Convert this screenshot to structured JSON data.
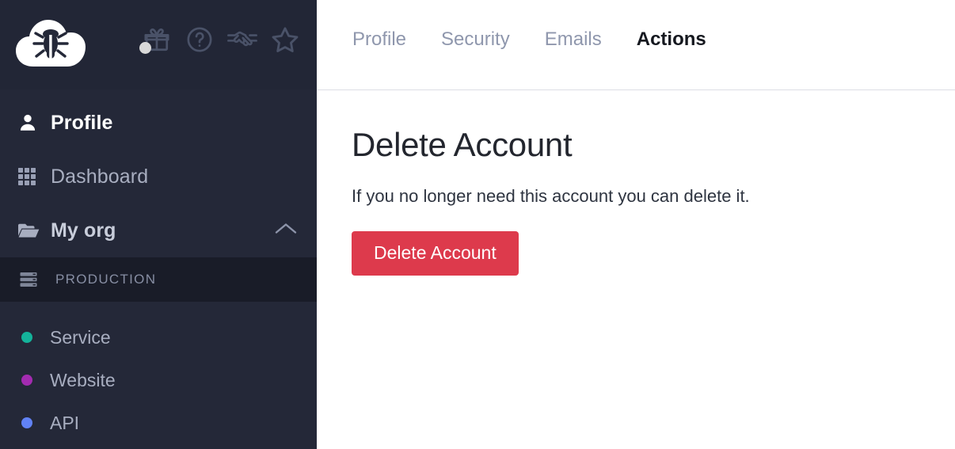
{
  "app": {
    "logo_icon": "cloud-bug-logo",
    "theme": {
      "sidebar_bg": "#242838",
      "sidebar_header_bg": "#222636",
      "env_row_bg": "#191c28",
      "content_bg": "#ffffff",
      "muted_text": "#a8aec0",
      "danger": "#dd3a4c",
      "active_tab": "#15181f"
    }
  },
  "header": {
    "icons": [
      {
        "name": "gift-icon",
        "label": "Gift",
        "has_notification": true
      },
      {
        "name": "help-circle-icon",
        "label": "Help"
      },
      {
        "name": "handshake-icon",
        "label": "Partners"
      },
      {
        "name": "star-icon",
        "label": "Favorites"
      }
    ]
  },
  "sidebar": {
    "items": [
      {
        "label": "Profile",
        "icon": "user-icon",
        "active": true
      },
      {
        "label": "Dashboard",
        "icon": "grid-icon",
        "active": false
      },
      {
        "label": "My org",
        "icon": "folder-open-icon",
        "active": false,
        "expanded": true,
        "chevron": "chevron-up-icon"
      }
    ],
    "environment": {
      "label": "PRODUCTION",
      "icon": "server-stack-icon"
    },
    "projects": [
      {
        "label": "Service",
        "dot_color": "#14b39a"
      },
      {
        "label": "Website",
        "dot_color": "#a32bb0"
      },
      {
        "label": "API",
        "dot_color": "#6182f5"
      }
    ]
  },
  "main": {
    "tabs": [
      {
        "label": "Profile",
        "active": false
      },
      {
        "label": "Security",
        "active": false
      },
      {
        "label": "Emails",
        "active": false
      },
      {
        "label": "Actions",
        "active": true
      }
    ],
    "page": {
      "title": "Delete Account",
      "description": "If you no longer need this account you can delete it.",
      "delete_button_label": "Delete Account"
    }
  }
}
